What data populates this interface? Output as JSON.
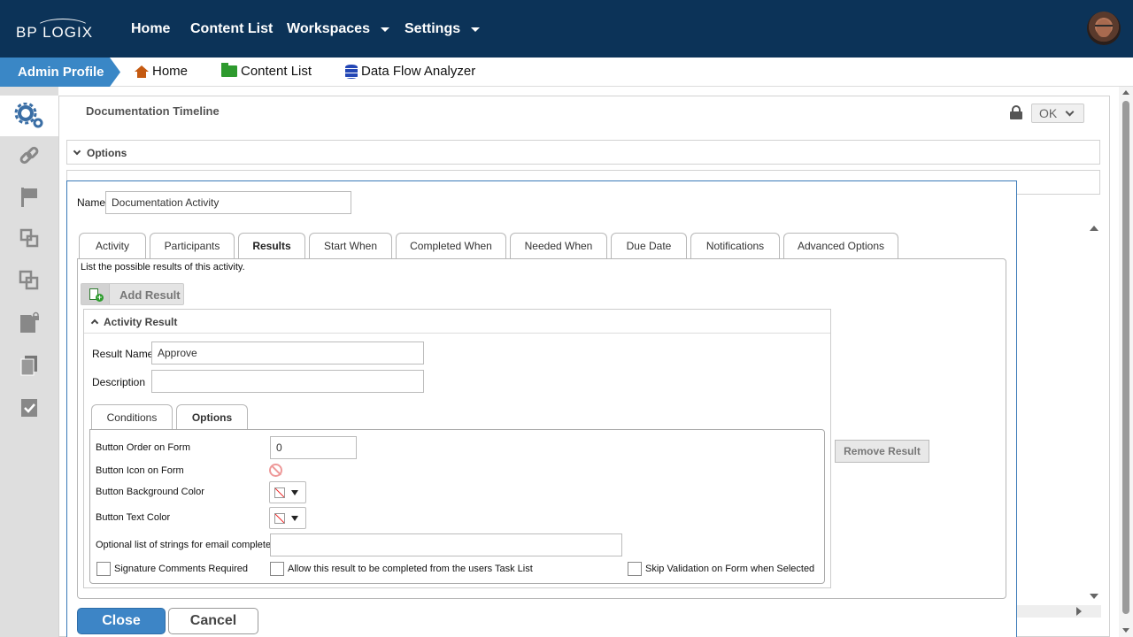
{
  "brand": {
    "logo_text": "BP LOGIX"
  },
  "topnav": {
    "home": "Home",
    "content_list": "Content List",
    "workspaces": "Workspaces",
    "settings": "Settings"
  },
  "breadcrumb": {
    "admin_profile": "Admin Profile",
    "home": "Home",
    "content_list": "Content List",
    "data_flow_analyzer": "Data Flow Analyzer"
  },
  "sidebar_icons": [
    "gear-icon",
    "link-icon",
    "flag-icon",
    "copy-frame-icon",
    "overlap-icon",
    "locked-doc-icon",
    "documents-icon",
    "checked-doc-icon"
  ],
  "page": {
    "title": "Documentation Timeline",
    "ok_label": "OK",
    "options_label": "Options"
  },
  "dialog": {
    "name_label": "Name",
    "name_value": "Documentation Activity",
    "tabs": [
      "Activity",
      "Participants",
      "Results",
      "Start When",
      "Completed When",
      "Needed When",
      "Due Date",
      "Notifications",
      "Advanced Options"
    ],
    "active_tab": "Results",
    "results_hint": "List the possible results of this activity.",
    "add_result_label": "Add Result",
    "activity_result_label": "Activity Result",
    "result_name_label": "Result Name",
    "result_name_value": "Approve",
    "description_label": "Description",
    "description_value": "",
    "inner_tabs": [
      "Conditions",
      "Options"
    ],
    "active_inner_tab": "Options",
    "button_order_label": "Button Order on Form",
    "button_order_value": "0",
    "button_icon_label": "Button Icon on Form",
    "button_bg_label": "Button Background Color",
    "button_text_color_label": "Button Text Color",
    "email_strings_label": "Optional list of strings for email complete",
    "email_strings_value": "",
    "sig_comments_label": "Signature Comments Required",
    "allow_tasklist_label": "Allow this result to be completed from the users Task List",
    "skip_validation_label": "Skip Validation on Form when Selected",
    "remove_result_label": "Remove Result",
    "close_label": "Close",
    "cancel_label": "Cancel"
  },
  "colors": {
    "topbar": "#0c3358",
    "accent": "#3a87c6",
    "close_button": "#3d85c6"
  }
}
